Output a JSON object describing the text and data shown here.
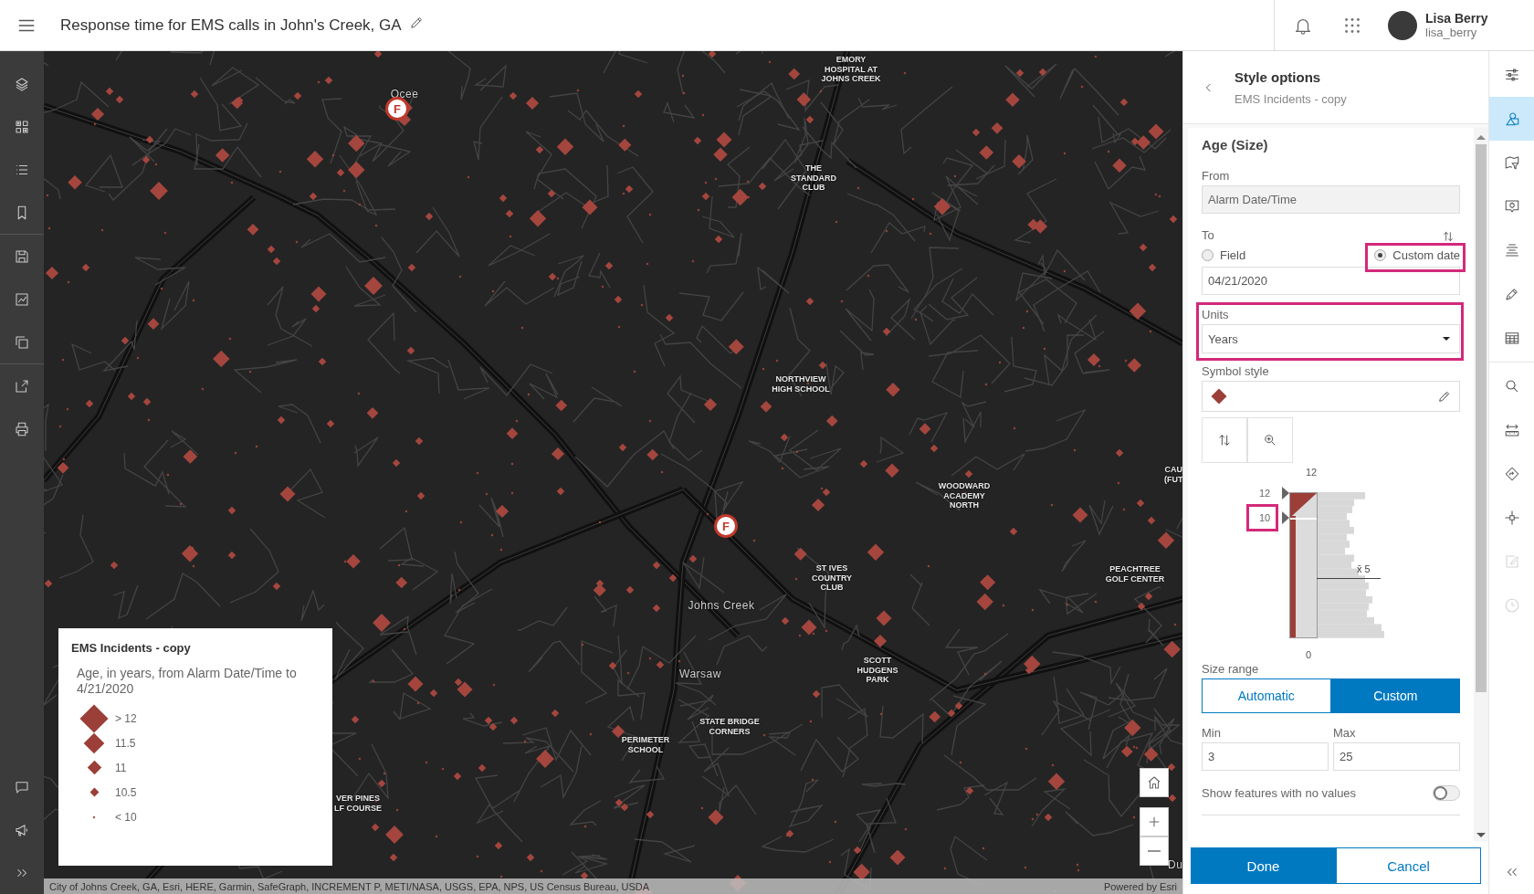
{
  "top_bar": {
    "title": "Response time for EMS calls in John's Creek, GA",
    "user": {
      "name": "Lisa Berry",
      "username": "lisa_berry"
    }
  },
  "map": {
    "labels": [
      {
        "kind": "locality",
        "lines": [
          "Ocee"
        ]
      },
      {
        "kind": "place",
        "lines": [
          "EMORY",
          "HOSPITAL AT",
          "JOHNS CREEK"
        ]
      },
      {
        "kind": "place",
        "lines": [
          "THE",
          "STANDARD",
          "CLUB"
        ]
      },
      {
        "kind": "place",
        "lines": [
          "NORTHVIEW",
          "HIGH SCHOOL"
        ]
      },
      {
        "kind": "place",
        "lines": [
          "WOODWARD",
          "ACADEMY",
          "NORTH"
        ]
      },
      {
        "kind": "place",
        "lines": [
          "ST IVES",
          "COUNTRY",
          "CLUB"
        ]
      },
      {
        "kind": "place",
        "lines": [
          "PEACHTREE",
          "GOLF CENTER"
        ]
      },
      {
        "kind": "locality",
        "lines": [
          "Johns Creek"
        ]
      },
      {
        "kind": "locality",
        "lines": [
          "Warsaw"
        ]
      },
      {
        "kind": "place",
        "lines": [
          "SCOTT",
          "HUDGENS",
          "PARK"
        ]
      },
      {
        "kind": "place",
        "lines": [
          "STATE BRIDGE",
          "CORNERS"
        ]
      },
      {
        "kind": "place",
        "lines": [
          "PERIMETER",
          "SCHOOL"
        ]
      },
      {
        "kind": "place",
        "lines": [
          "VER PINES",
          "LF COURSE"
        ]
      },
      {
        "kind": "place",
        "lines": [
          "CAU",
          "(FUT"
        ]
      },
      {
        "kind": "locality",
        "lines": [
          "Du"
        ]
      }
    ],
    "fire_stations": [
      {
        "label": "F"
      },
      {
        "label": "F"
      }
    ],
    "attribution": "City of Johns Creek, GA, Esri, HERE, Garmin, SafeGraph, INCREMENT P, METI/NASA, USGS, EPA, NPS, US Census Bureau, USDA",
    "powered_by": "Powered by Esri"
  },
  "legend": {
    "title": "EMS Incidents - copy",
    "description": "Age, in years, from Alarm Date/Time to 4/21/2020",
    "items": [
      {
        "label": "> 12"
      },
      {
        "label": "11.5"
      },
      {
        "label": "11"
      },
      {
        "label": "10.5"
      },
      {
        "label": "< 10"
      }
    ]
  },
  "panel": {
    "title": "Style options",
    "subtitle": "EMS Incidents - copy",
    "section": "Age (Size)",
    "from": {
      "label": "From",
      "value": "Alarm Date/Time",
      "disabled": true
    },
    "to": {
      "label": "To",
      "options": [
        {
          "label": "Field",
          "selected": false,
          "highlighted": false
        },
        {
          "label": "Custom date",
          "selected": true,
          "highlighted": true
        }
      ],
      "date": "04/21/2020"
    },
    "units": {
      "label": "Units",
      "value": "Years",
      "highlighted": true
    },
    "symbol_style": {
      "label": "Symbol style"
    },
    "histogram": {
      "top_label": "12",
      "bottom_label": "0",
      "handles": [
        {
          "label": "12",
          "level": 1,
          "highlighted": false
        },
        {
          "label": "10",
          "level": 0.833,
          "highlighted": true
        }
      ],
      "average": {
        "label": "x̄ 5",
        "level": 0.41
      }
    },
    "size_range": {
      "label": "Size range",
      "options": [
        {
          "label": "Automatic",
          "selected": false
        },
        {
          "label": "Custom",
          "selected": true
        }
      ],
      "min": {
        "label": "Min",
        "value": "3"
      },
      "max": {
        "label": "Max",
        "value": "25"
      }
    },
    "show_no_values": {
      "label": "Show features with no values",
      "on": false
    },
    "buttons": [
      {
        "label": "Done",
        "kind": "primary"
      },
      {
        "label": "Cancel",
        "kind": "secondary"
      }
    ]
  },
  "right_toolbar": {
    "items": [
      {
        "selected": false,
        "disabled": false
      },
      {
        "selected": true,
        "disabled": false
      },
      {
        "selected": false,
        "disabled": false
      },
      {
        "selected": false,
        "disabled": false
      },
      {
        "selected": false,
        "disabled": false
      },
      {
        "selected": false,
        "disabled": false
      },
      {
        "selected": false,
        "disabled": false
      },
      {
        "selected": false,
        "disabled": false
      },
      {
        "selected": false,
        "disabled": false
      },
      {
        "selected": false,
        "disabled": false
      },
      {
        "selected": false,
        "disabled": false
      },
      {
        "selected": false,
        "disabled": true
      },
      {
        "selected": false,
        "disabled": true
      }
    ]
  }
}
